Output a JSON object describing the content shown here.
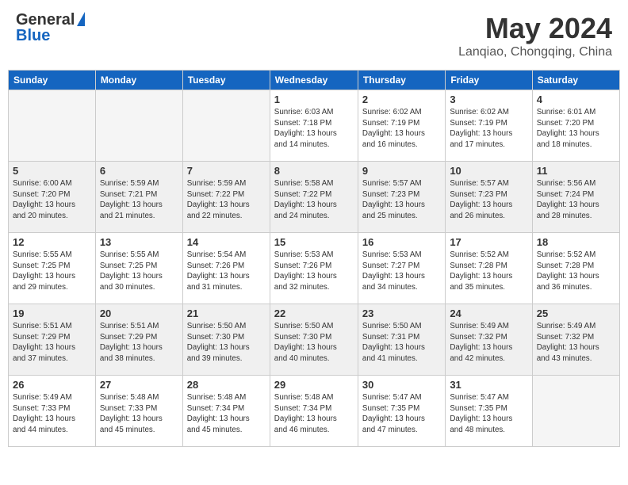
{
  "header": {
    "logo_general": "General",
    "logo_blue": "Blue",
    "month": "May 2024",
    "location": "Lanqiao, Chongqing, China"
  },
  "weekdays": [
    "Sunday",
    "Monday",
    "Tuesday",
    "Wednesday",
    "Thursday",
    "Friday",
    "Saturday"
  ],
  "weeks": [
    [
      {
        "day": "",
        "info": ""
      },
      {
        "day": "",
        "info": ""
      },
      {
        "day": "",
        "info": ""
      },
      {
        "day": "1",
        "info": "Sunrise: 6:03 AM\nSunset: 7:18 PM\nDaylight: 13 hours\nand 14 minutes."
      },
      {
        "day": "2",
        "info": "Sunrise: 6:02 AM\nSunset: 7:19 PM\nDaylight: 13 hours\nand 16 minutes."
      },
      {
        "day": "3",
        "info": "Sunrise: 6:02 AM\nSunset: 7:19 PM\nDaylight: 13 hours\nand 17 minutes."
      },
      {
        "day": "4",
        "info": "Sunrise: 6:01 AM\nSunset: 7:20 PM\nDaylight: 13 hours\nand 18 minutes."
      }
    ],
    [
      {
        "day": "5",
        "info": "Sunrise: 6:00 AM\nSunset: 7:20 PM\nDaylight: 13 hours\nand 20 minutes."
      },
      {
        "day": "6",
        "info": "Sunrise: 5:59 AM\nSunset: 7:21 PM\nDaylight: 13 hours\nand 21 minutes."
      },
      {
        "day": "7",
        "info": "Sunrise: 5:59 AM\nSunset: 7:22 PM\nDaylight: 13 hours\nand 22 minutes."
      },
      {
        "day": "8",
        "info": "Sunrise: 5:58 AM\nSunset: 7:22 PM\nDaylight: 13 hours\nand 24 minutes."
      },
      {
        "day": "9",
        "info": "Sunrise: 5:57 AM\nSunset: 7:23 PM\nDaylight: 13 hours\nand 25 minutes."
      },
      {
        "day": "10",
        "info": "Sunrise: 5:57 AM\nSunset: 7:23 PM\nDaylight: 13 hours\nand 26 minutes."
      },
      {
        "day": "11",
        "info": "Sunrise: 5:56 AM\nSunset: 7:24 PM\nDaylight: 13 hours\nand 28 minutes."
      }
    ],
    [
      {
        "day": "12",
        "info": "Sunrise: 5:55 AM\nSunset: 7:25 PM\nDaylight: 13 hours\nand 29 minutes."
      },
      {
        "day": "13",
        "info": "Sunrise: 5:55 AM\nSunset: 7:25 PM\nDaylight: 13 hours\nand 30 minutes."
      },
      {
        "day": "14",
        "info": "Sunrise: 5:54 AM\nSunset: 7:26 PM\nDaylight: 13 hours\nand 31 minutes."
      },
      {
        "day": "15",
        "info": "Sunrise: 5:53 AM\nSunset: 7:26 PM\nDaylight: 13 hours\nand 32 minutes."
      },
      {
        "day": "16",
        "info": "Sunrise: 5:53 AM\nSunset: 7:27 PM\nDaylight: 13 hours\nand 34 minutes."
      },
      {
        "day": "17",
        "info": "Sunrise: 5:52 AM\nSunset: 7:28 PM\nDaylight: 13 hours\nand 35 minutes."
      },
      {
        "day": "18",
        "info": "Sunrise: 5:52 AM\nSunset: 7:28 PM\nDaylight: 13 hours\nand 36 minutes."
      }
    ],
    [
      {
        "day": "19",
        "info": "Sunrise: 5:51 AM\nSunset: 7:29 PM\nDaylight: 13 hours\nand 37 minutes."
      },
      {
        "day": "20",
        "info": "Sunrise: 5:51 AM\nSunset: 7:29 PM\nDaylight: 13 hours\nand 38 minutes."
      },
      {
        "day": "21",
        "info": "Sunrise: 5:50 AM\nSunset: 7:30 PM\nDaylight: 13 hours\nand 39 minutes."
      },
      {
        "day": "22",
        "info": "Sunrise: 5:50 AM\nSunset: 7:30 PM\nDaylight: 13 hours\nand 40 minutes."
      },
      {
        "day": "23",
        "info": "Sunrise: 5:50 AM\nSunset: 7:31 PM\nDaylight: 13 hours\nand 41 minutes."
      },
      {
        "day": "24",
        "info": "Sunrise: 5:49 AM\nSunset: 7:32 PM\nDaylight: 13 hours\nand 42 minutes."
      },
      {
        "day": "25",
        "info": "Sunrise: 5:49 AM\nSunset: 7:32 PM\nDaylight: 13 hours\nand 43 minutes."
      }
    ],
    [
      {
        "day": "26",
        "info": "Sunrise: 5:49 AM\nSunset: 7:33 PM\nDaylight: 13 hours\nand 44 minutes."
      },
      {
        "day": "27",
        "info": "Sunrise: 5:48 AM\nSunset: 7:33 PM\nDaylight: 13 hours\nand 45 minutes."
      },
      {
        "day": "28",
        "info": "Sunrise: 5:48 AM\nSunset: 7:34 PM\nDaylight: 13 hours\nand 45 minutes."
      },
      {
        "day": "29",
        "info": "Sunrise: 5:48 AM\nSunset: 7:34 PM\nDaylight: 13 hours\nand 46 minutes."
      },
      {
        "day": "30",
        "info": "Sunrise: 5:47 AM\nSunset: 7:35 PM\nDaylight: 13 hours\nand 47 minutes."
      },
      {
        "day": "31",
        "info": "Sunrise: 5:47 AM\nSunset: 7:35 PM\nDaylight: 13 hours\nand 48 minutes."
      },
      {
        "day": "",
        "info": ""
      }
    ]
  ]
}
